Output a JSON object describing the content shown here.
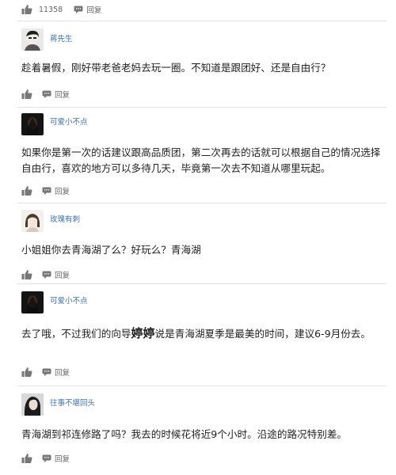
{
  "top_actions": {
    "like_count": "11358",
    "reply_label": "回复"
  },
  "comments": [
    {
      "username": "蒋先生",
      "avatar": "avatar-man",
      "text": "趁着暑假，刚好带老爸老妈去玩一圈。不知道是跟团好、还是自由行？",
      "reply_label": "回复"
    },
    {
      "username": "可爱小不点",
      "avatar": "avatar-dark",
      "text": "如果你是第一次的话建议跟高品质团，第二次再去的话就可以根据自己的情况选择自由行，喜欢的地方可以多待几天，毕竟第一次去不知道从哪里玩起。",
      "reply_label": "回复"
    },
    {
      "username": "玫瑰有刺",
      "avatar": "avatar-girl",
      "text": "小姐姐你去青海湖了么？好玩么？青海湖",
      "reply_label": "回复"
    },
    {
      "username": "可爱小不点",
      "avatar": "avatar-dark",
      "text_part1": "去了哦，不过我们的向导",
      "text_big": "婷婷",
      "text_part2": "说是青海湖夏季是最美的时间，建议6-9月份去。",
      "reply_label": "回复"
    },
    {
      "username": "往事不堪回头",
      "avatar": "avatar-woman",
      "text": "青海湖到祁连修路了吗？我去的时候花将近9个小时。沿途的路况特别差。",
      "reply_label": "回复"
    }
  ]
}
